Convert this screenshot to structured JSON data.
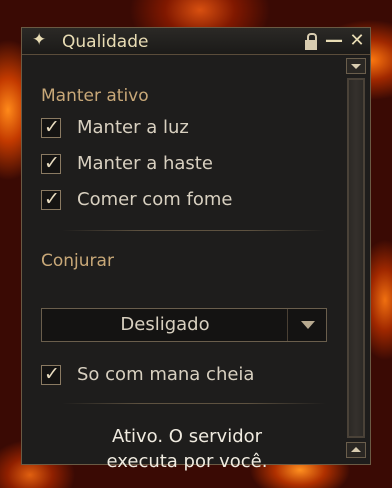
{
  "window": {
    "title": "Qualidade",
    "title_icon": "star-icon",
    "controls": [
      "lock-icon",
      "minimize-icon",
      "close-icon"
    ],
    "close_glyph": "✕",
    "minimize_glyph": "—"
  },
  "keep_active": {
    "label": "Manter ativo",
    "options": [
      {
        "label": "Manter a luz",
        "checked": true
      },
      {
        "label": "Manter a haste",
        "checked": true
      },
      {
        "label": "Comer com fome",
        "checked": true
      }
    ]
  },
  "conjure": {
    "label": "Conjurar",
    "select_value": "Desligado",
    "option": {
      "label": "So com mana cheia",
      "checked": true
    }
  },
  "status": {
    "line1": "Ativo. O servidor",
    "line2": "executa por você."
  },
  "check_glyph": "✓",
  "colors": {
    "section_label": "#c8a878",
    "text": "#d8d0c0",
    "window_bg": "#1e1d1c",
    "border": "#6a5a44"
  }
}
